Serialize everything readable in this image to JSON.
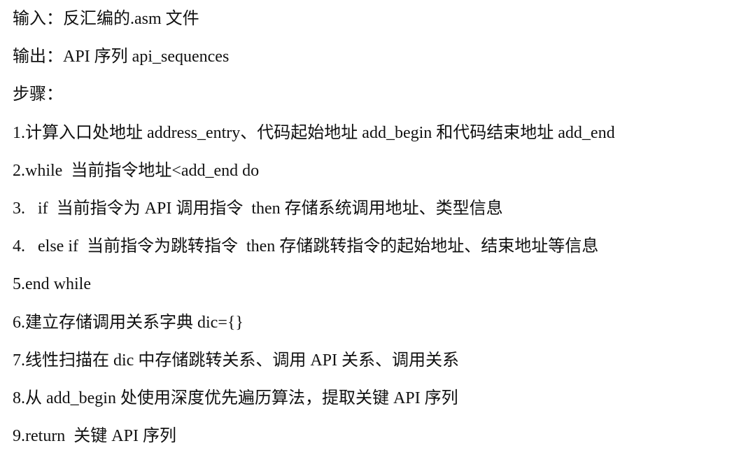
{
  "lines": [
    "输入：反汇编的.asm 文件",
    "输出：API 序列 api_sequences",
    "步骤：",
    "1.计算入口处地址 address_entry、代码起始地址 add_begin 和代码结束地址 add_end",
    "2.while  当前指令地址<add_end do",
    "3.   if  当前指令为 API 调用指令  then 存储系统调用地址、类型信息",
    "4.   else if  当前指令为跳转指令  then 存储跳转指令的起始地址、结束地址等信息",
    "5.end while",
    "6.建立存储调用关系字典 dic={}",
    "7.线性扫描在 dic 中存储跳转关系、调用 API 关系、调用关系",
    "8.从 add_begin 处使用深度优先遍历算法，提取关键 API 序列",
    "9.return  关键 API 序列"
  ]
}
